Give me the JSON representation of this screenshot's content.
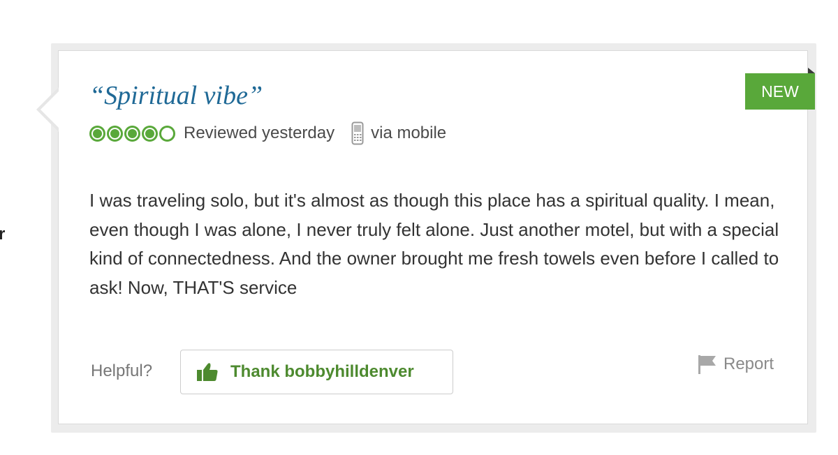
{
  "sidebar_fragment": "r",
  "review": {
    "title": "“Spiritual vibe”",
    "badge": "NEW",
    "rating": {
      "value": 4,
      "max": 5
    },
    "reviewed_when": "Reviewed yesterday",
    "via": "via mobile",
    "body": "I was traveling solo, but it's almost as though this place has a spiritual quality. I mean, even though I was alone, I never truly felt alone. Just another motel, but with a special kind of connectedness. And the owner brought me fresh towels even before I called to ask! Now, THAT'S service"
  },
  "actions": {
    "helpful_label": "Helpful?",
    "thank_label": "Thank bobbyhilldenver",
    "report_label": "Report"
  },
  "icons": {
    "device": "mobile-phone-icon",
    "thank": "thumbs-up-icon",
    "report": "flag-icon"
  },
  "colors": {
    "accent_green": "#59a83a",
    "title_blue": "#1f6996",
    "thank_green": "#4d8a2f"
  }
}
